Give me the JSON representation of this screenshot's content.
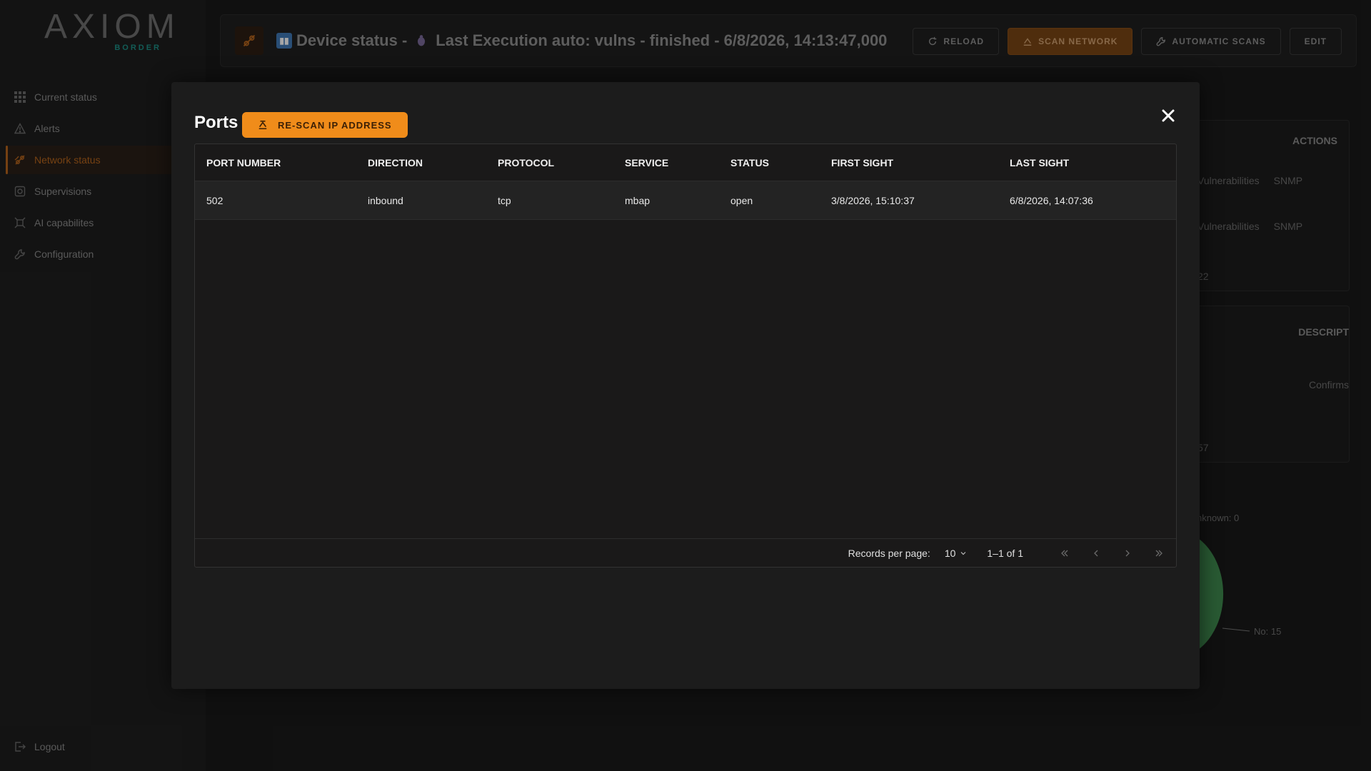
{
  "brand": {
    "name": "AXIOM",
    "sub": "BORDER"
  },
  "sidebar": {
    "items": [
      {
        "label": "Current status",
        "icon": "grid-icon"
      },
      {
        "label": "Alerts",
        "icon": "warning-icon"
      },
      {
        "label": "Network status",
        "icon": "network-icon",
        "active": true
      },
      {
        "label": "Supervisions",
        "icon": "supervision-icon"
      },
      {
        "label": "AI capabilites",
        "icon": "ai-icon"
      },
      {
        "label": "Configuration",
        "icon": "wrench-icon"
      }
    ],
    "logout": "Logout"
  },
  "header": {
    "title_part1": "Device status -",
    "title_part2": "Last Execution auto: vulns - finished - 6/8/2026, 14:13:47,000",
    "buttons": {
      "reload": "RELOAD",
      "scan_network": "SCAN NETWORK",
      "automatic_scans": "AUTOMATIC SCANS",
      "edit": "EDIT"
    }
  },
  "background": {
    "actions_header": "ACTIONS",
    "row_links": [
      "Vulnerabilities",
      "SNMP",
      "Vulnerabilities",
      "SNMP"
    ],
    "pager1_count": "22",
    "description_header": "DESCRIPT",
    "confirms": "Confirms",
    "pager2_count": "57",
    "unknown": "nknown: 0",
    "no_label": "No: 15"
  },
  "modal": {
    "title": "Ports",
    "rescan_label": "RE-SCAN IP ADDRESS",
    "columns": [
      "PORT NUMBER",
      "DIRECTION",
      "PROTOCOL",
      "SERVICE",
      "STATUS",
      "FIRST SIGHT",
      "LAST SIGHT"
    ],
    "rows": [
      [
        "502",
        "inbound",
        "tcp",
        "mbap",
        "open",
        "3/8/2026, 15:10:37",
        "6/8/2026, 14:07:36"
      ]
    ],
    "pager": {
      "records_label": "Records per page:",
      "per_page": "10",
      "range": "1–1 of 1"
    }
  },
  "colors": {
    "accent": "#b5651d",
    "button_orange": "#f08c1a",
    "chart_green": "#3f8a4f"
  }
}
